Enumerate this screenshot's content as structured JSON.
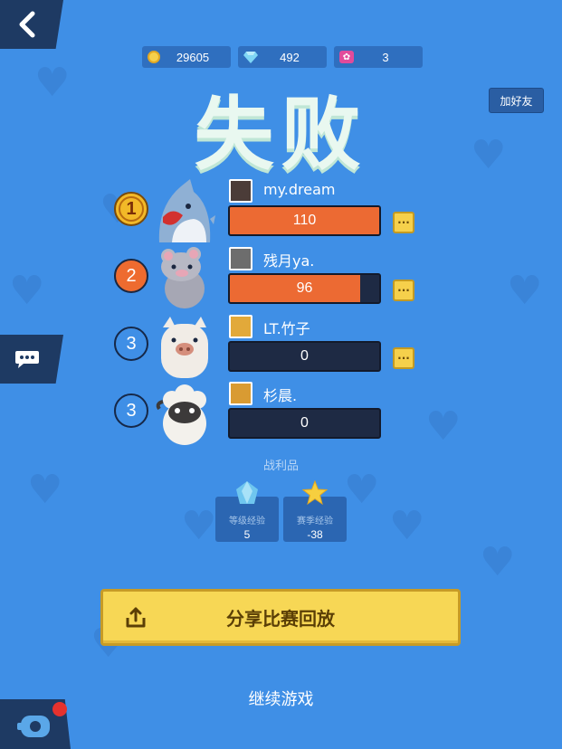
{
  "currency": {
    "coins": "29605",
    "diamonds": "492",
    "tickets": "3"
  },
  "header": {
    "result_title": "失败",
    "add_friend_label": "加好友"
  },
  "players": [
    {
      "rank": "1",
      "name": "my.dream",
      "score": "110",
      "fill": 1.0,
      "rank_style": "gold",
      "character": "shark-icon",
      "has_more": true
    },
    {
      "rank": "2",
      "name": "残月ya.",
      "score": "96",
      "fill": 0.87,
      "rank_style": "orange",
      "character": "rat-icon",
      "has_more": true
    },
    {
      "rank": "3",
      "name": "LT.竹子",
      "score": "0",
      "fill": 0,
      "rank_style": "blue",
      "character": "pig-icon",
      "has_more": true
    },
    {
      "rank": "3",
      "name": "杉晨.",
      "score": "0",
      "fill": 0,
      "rank_style": "blue",
      "character": "sheep-icon",
      "has_more": false
    }
  ],
  "loot": {
    "title": "战利品",
    "items": [
      {
        "label": "等级经验",
        "value": "5",
        "icon": "blue-crystal-icon"
      },
      {
        "label": "赛季经验",
        "value": "-38",
        "icon": "star-icon"
      }
    ]
  },
  "actions": {
    "share_label": "分享比赛回放",
    "continue_label": "继续游戏"
  },
  "colors": {
    "background": "#3f8fe6",
    "score_fill": "#ec6a33",
    "accent_yellow": "#f7d755"
  }
}
